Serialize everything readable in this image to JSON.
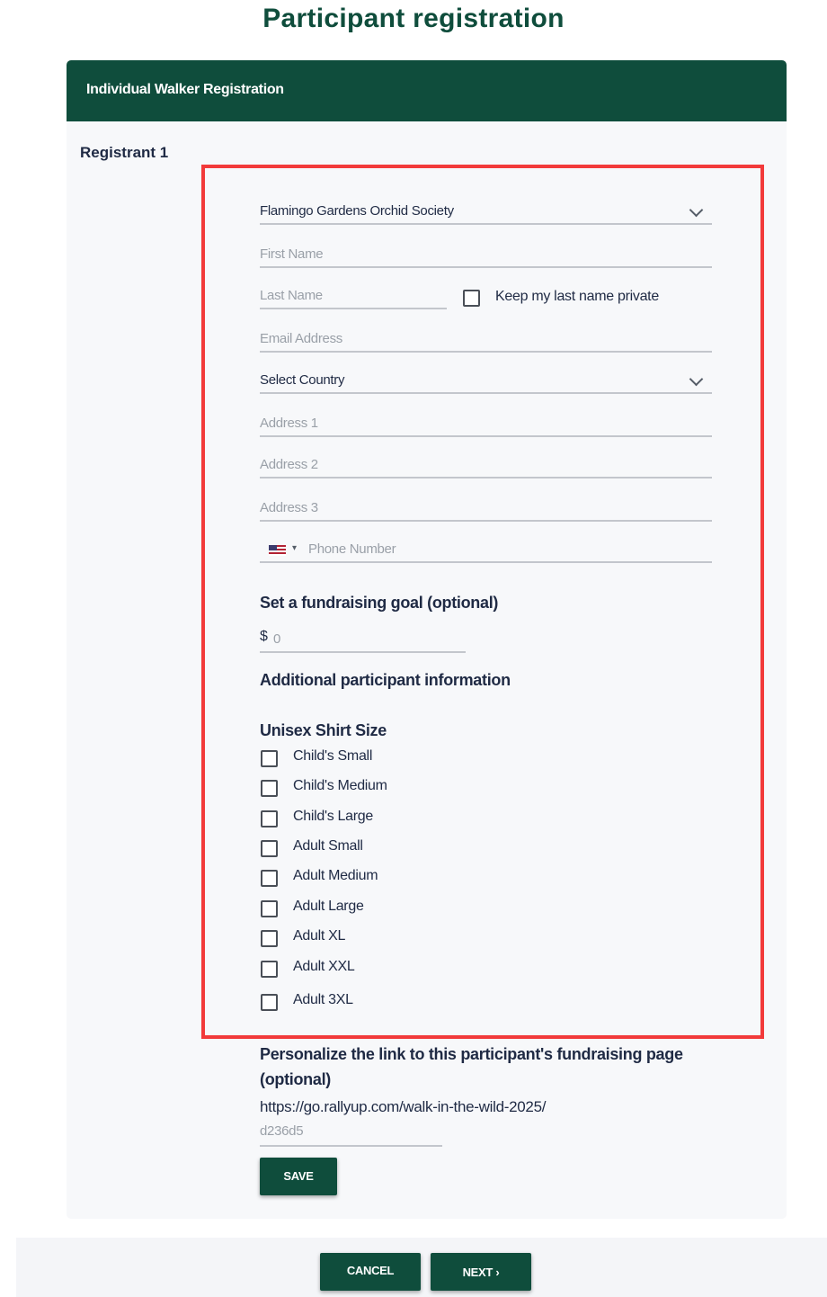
{
  "page": {
    "title": "Participant registration"
  },
  "card": {
    "header": "Individual Walker Registration",
    "registrant": "Registrant 1"
  },
  "form": {
    "organization": "Flamingo Gardens Orchid Society",
    "first_name_placeholder": "First Name",
    "last_name_placeholder": "Last Name",
    "keep_private_label": "Keep my last name private",
    "email_placeholder": "Email Address",
    "country": "Select Country",
    "address1_placeholder": "Address 1",
    "address2_placeholder": "Address 2",
    "address3_placeholder": "Address 3",
    "phone_placeholder": "Phone Number"
  },
  "goal": {
    "title": "Set a fundraising goal (optional)",
    "currency": "$",
    "value": "0"
  },
  "additional": {
    "title": "Additional participant information",
    "shirt_title": "Unisex Shirt Size",
    "sizes": [
      "Child's Small",
      "Child's Medium",
      "Child's Large",
      "Adult Small",
      "Adult Medium",
      "Adult Large",
      "Adult XL",
      "Adult XXL",
      "Adult 3XL"
    ]
  },
  "personalize": {
    "title": "Personalize the link to this participant's fundraising page (optional)",
    "url_prefix": "https://go.rallyup.com/walk-in-the-wild-2025/",
    "slug_placeholder": "d236d5",
    "save_label": "SAVE"
  },
  "footer": {
    "cancel_label": "CANCEL",
    "next_label": "NEXT ›"
  },
  "colors": {
    "brand": "#0f4d3c",
    "highlight": "#f23a3a"
  }
}
